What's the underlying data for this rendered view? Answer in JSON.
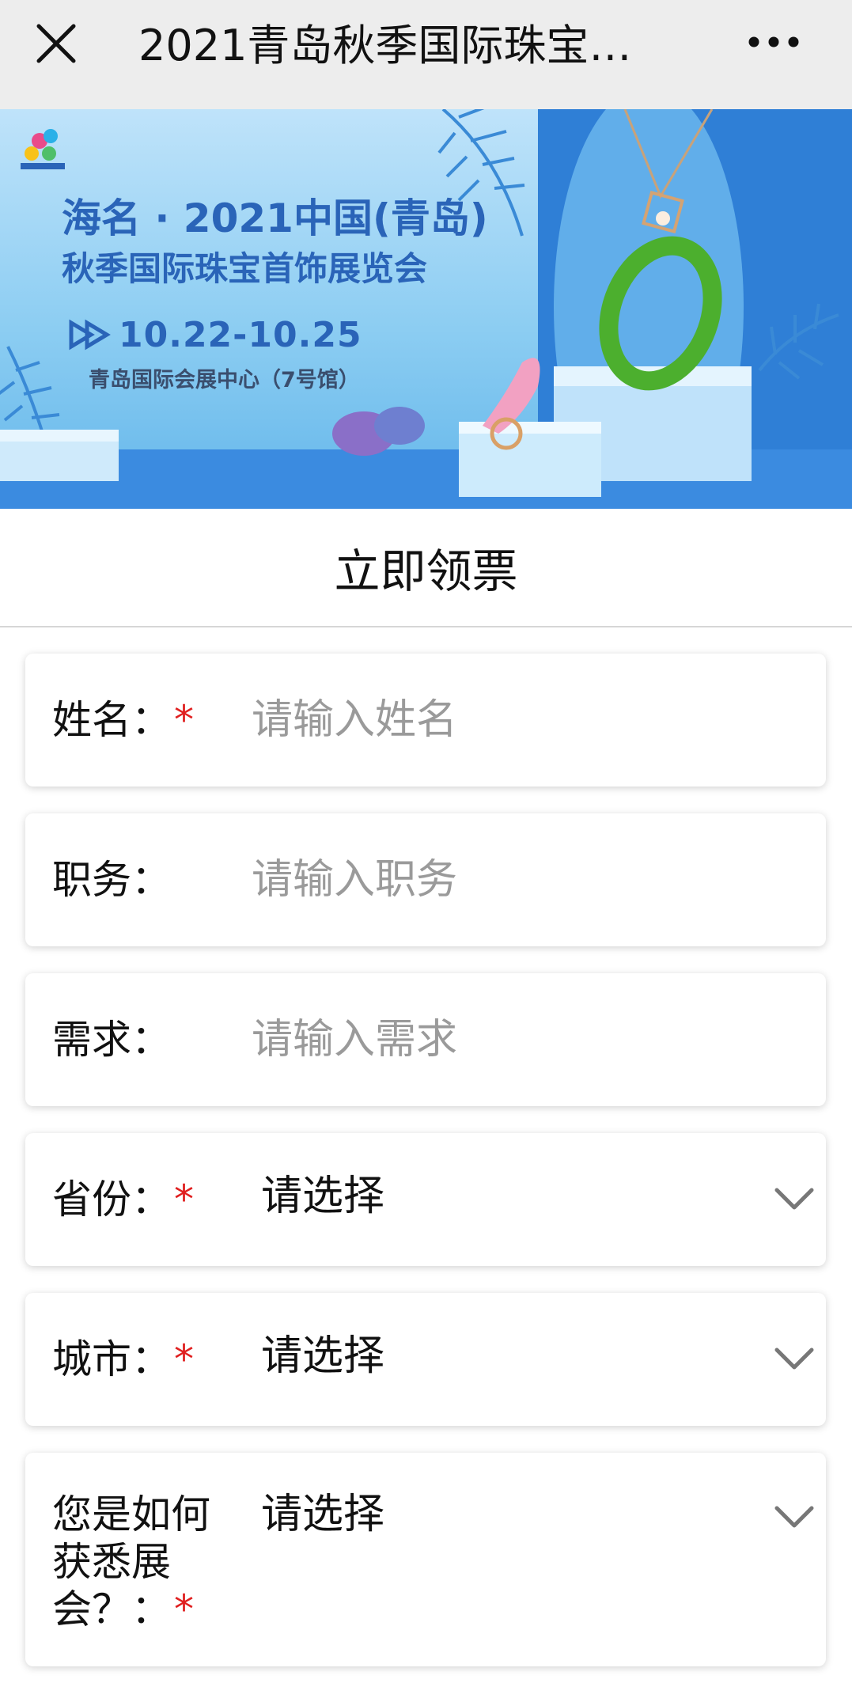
{
  "nav": {
    "title": "2021青岛秋季国际珠宝…",
    "close_icon": "close-icon",
    "more_icon": "more-dots-icon"
  },
  "banner": {
    "title_line1": "海名 · 2021中国(青岛)",
    "title_line2": "秋季国际珠宝首饰展览会",
    "date": "10.22-10.25",
    "venue": "青岛国际会展中心（7号馆）"
  },
  "section": {
    "title": "立即领票"
  },
  "form": {
    "name_label": "姓名：",
    "name_placeholder": "请输入姓名",
    "position_label": "职务：",
    "position_placeholder": "请输入职务",
    "need_label": "需求：",
    "need_placeholder": "请输入需求",
    "province_label": "省份：",
    "province_value": "请选择",
    "city_label": "城市：",
    "city_value": "请选择",
    "source_label": "您是如何获悉展会？：",
    "source_value": "请选择",
    "required_mark": "*"
  },
  "colors": {
    "required": "#e02020",
    "banner_blue": "#2a64b8",
    "topbar_bg": "#ededed"
  }
}
